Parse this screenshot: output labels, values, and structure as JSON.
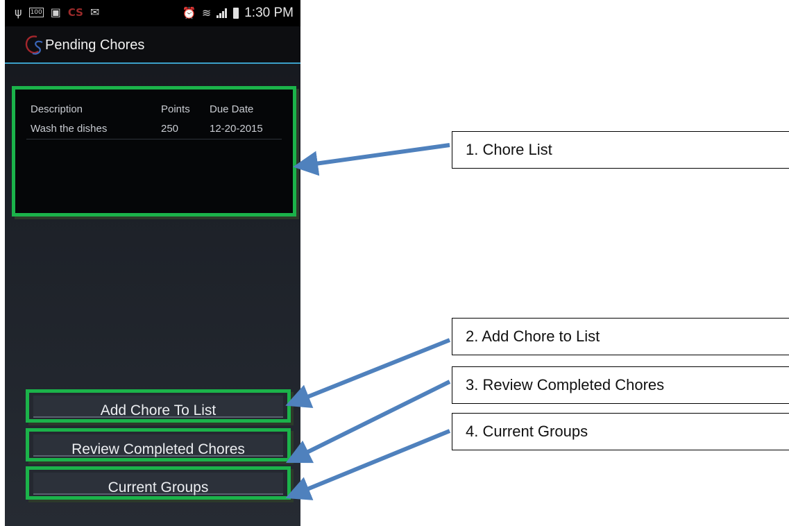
{
  "status_bar": {
    "time": "1:30 PM",
    "icons": [
      "usb-icon",
      "battery-100-icon",
      "image-icon",
      "cs-app-icon",
      "mail-icon",
      "alarm-icon",
      "wifi-icon",
      "signal-icon",
      "battery-icon"
    ],
    "battery_label": "100",
    "app_glyph": "CS"
  },
  "action_bar": {
    "logo_text": "CS",
    "title": "Pending Chores"
  },
  "chore_list": {
    "headers": [
      "Description",
      "Points",
      "Due Date"
    ],
    "rows": [
      {
        "description": "Wash the dishes",
        "points": "250",
        "due_date": "12-20-2015"
      }
    ]
  },
  "buttons": {
    "add": "Add Chore To List",
    "review": "Review Completed Chores",
    "groups": "Current Groups"
  },
  "callouts": [
    "1. Chore List",
    "2. Add Chore to List",
    "3. Review Completed Chores",
    "4. Current Groups"
  ],
  "colors": {
    "highlight": "#1bb34a",
    "arrow": "#4f81bd",
    "divider": "#3ba0c9"
  }
}
